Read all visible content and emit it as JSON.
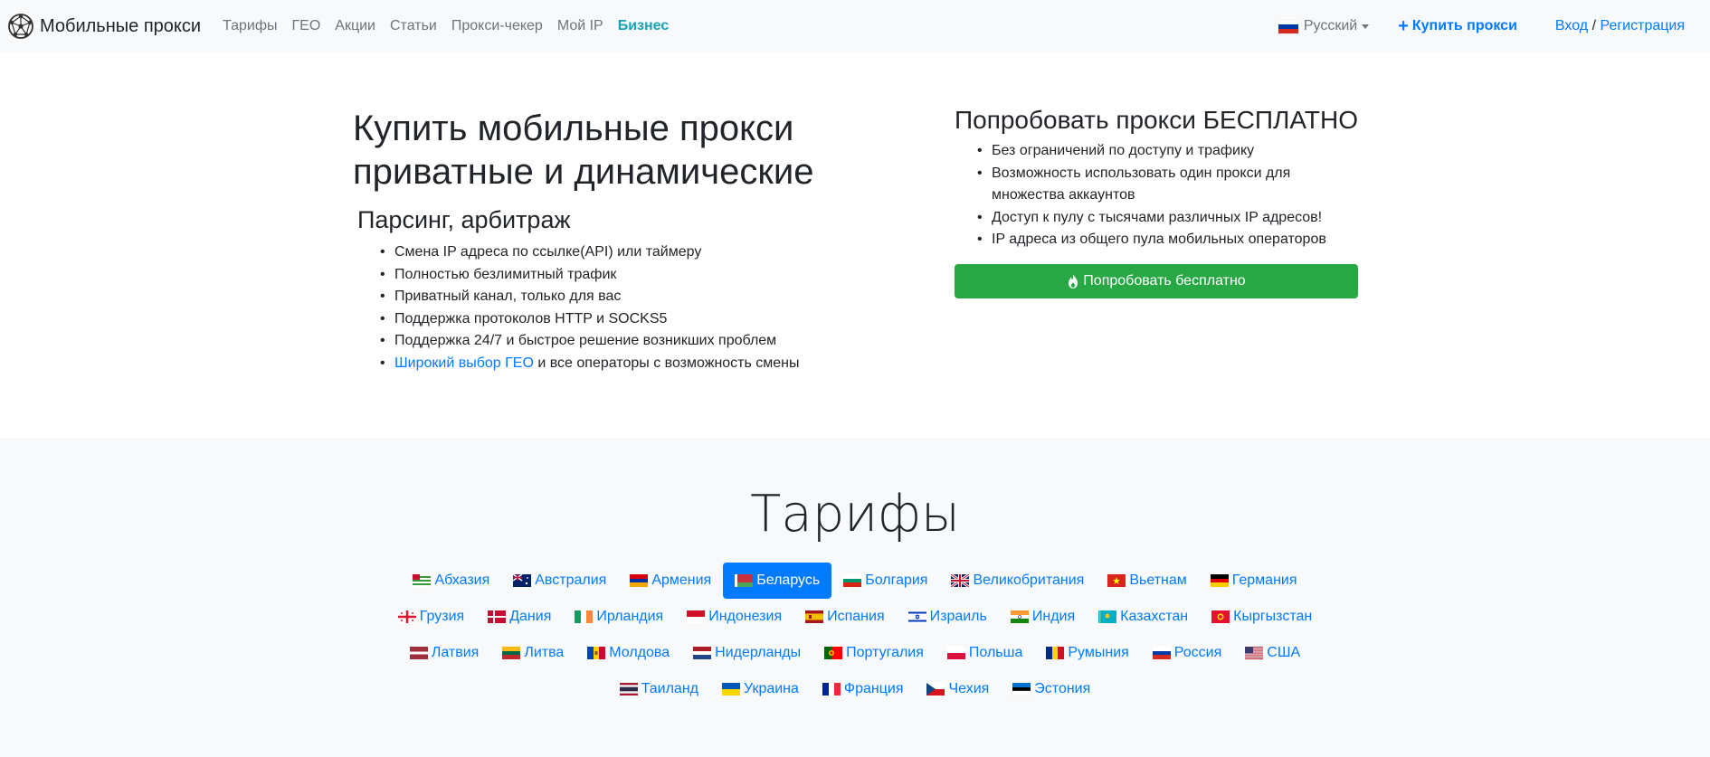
{
  "nav": {
    "brand": "Мобильные прокси",
    "links": [
      "Тарифы",
      "ГЕО",
      "Акции",
      "Статьи",
      "Прокси-чекер",
      "Мой IP"
    ],
    "business": "Бизнес",
    "language": "Русский",
    "buy": "Купить прокси",
    "login": "Вход",
    "separator": " / ",
    "register": "Регистрация"
  },
  "hero": {
    "title": "Купить мобильные прокси приватные и динамические",
    "subtitle": "Парсинг, арбитраж",
    "features": [
      "Смена IP адреса по ссылке(API) или таймеру",
      "Полностью безлимитный трафик",
      "Приватный канал, только для вас",
      "Поддержка протоколов HTTP и SOCKS5",
      "Поддержка 24/7 и быстрое решение возникших проблем"
    ],
    "geo_link": "Широкий выбор ГЕО",
    "geo_rest": " и все операторы с возможность смены",
    "trial_title": "Попробовать прокси БЕСПЛАТНО",
    "trial_features": [
      "Без ограничений по доступу и трафику",
      "Возможность использовать один прокси для множества аккаунтов",
      "Доступ к пулу с тысячами различных IP адресов!",
      "IP адреса из общего пула мобильных операторов"
    ],
    "trial_button": "Попробовать бесплатно"
  },
  "tariffs": {
    "title": "Тарифы",
    "selected": "Беларусь",
    "countries": [
      "Абхазия",
      "Австралия",
      "Армения",
      "Беларусь",
      "Болгария",
      "Великобритания",
      "Вьетнам",
      "Германия",
      "Грузия",
      "Дания",
      "Ирландия",
      "Индонезия",
      "Испания",
      "Израиль",
      "Индия",
      "Казахстан",
      "Кыргызстан",
      "Латвия",
      "Литва",
      "Молдова",
      "Нидерланды",
      "Португалия",
      "Польша",
      "Румыния",
      "Россия",
      "США",
      "Таиланд",
      "Украина",
      "Франция",
      "Чехия",
      "Эстония"
    ]
  },
  "colors": {
    "link": "#007bff",
    "business": "#17a2b8",
    "trial_button": "#28a745",
    "muted": "#6c757d"
  }
}
